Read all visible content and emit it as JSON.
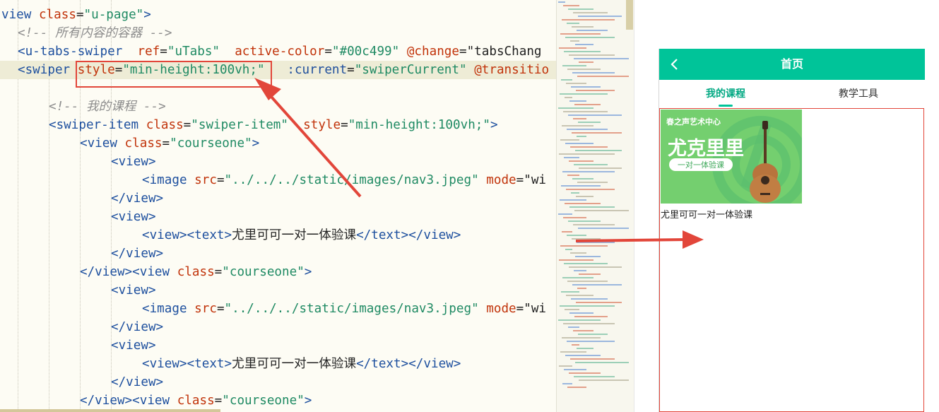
{
  "editor": {
    "lines": [
      [
        [
          "tag",
          "view"
        ],
        [
          "attr",
          " class"
        ],
        [
          "txt",
          "="
        ],
        [
          "str",
          "\"u-page\""
        ],
        [
          "tag",
          ">"
        ]
      ],
      [
        [
          "cmt",
          "<!-- 所有内容的容器 -->"
        ]
      ],
      [
        [
          "tag",
          "<u-tabs-swiper"
        ],
        [
          "attr",
          "  ref"
        ],
        [
          "txt",
          "="
        ],
        [
          "str",
          "\"uTabs\""
        ],
        [
          "attr",
          "  active-color"
        ],
        [
          "txt",
          "="
        ],
        [
          "str",
          "\"#00c499\""
        ],
        [
          "ev",
          " @change"
        ],
        [
          "txt",
          "=\"tabsChang"
        ]
      ],
      [
        [
          "tag",
          "<swiper"
        ],
        [
          "txt",
          " "
        ],
        [
          "attr",
          "style"
        ],
        [
          "txt",
          "="
        ],
        [
          "str",
          "\"min-height:100vh;\""
        ],
        [
          "txt",
          "  "
        ],
        [
          "bind",
          " :current"
        ],
        [
          "txt",
          "="
        ],
        [
          "str",
          "\"swiperCurrent\""
        ],
        [
          "txt",
          " "
        ],
        [
          "ev",
          "@transitio"
        ]
      ],
      [],
      [
        [
          "cmt",
          "<!-- 我的课程 -->"
        ]
      ],
      [
        [
          "tag",
          "<swiper-item"
        ],
        [
          "attr",
          " class"
        ],
        [
          "txt",
          "="
        ],
        [
          "str",
          "\"swiper-item\""
        ],
        [
          "attr",
          "  style"
        ],
        [
          "txt",
          "="
        ],
        [
          "str",
          "\"min-height:100vh;\""
        ],
        [
          "tag",
          ">"
        ]
      ],
      [
        [
          "tag",
          "<view"
        ],
        [
          "attr",
          " class"
        ],
        [
          "txt",
          "="
        ],
        [
          "str",
          "\"courseone\""
        ],
        [
          "tag",
          ">"
        ]
      ],
      [
        [
          "tag",
          "<view>"
        ]
      ],
      [
        [
          "tag",
          "<image"
        ],
        [
          "attr",
          " src"
        ],
        [
          "txt",
          "="
        ],
        [
          "str",
          "\"../../../static/images/nav3.jpeg\""
        ],
        [
          "attr",
          " mode"
        ],
        [
          "txt",
          "=\"wi"
        ]
      ],
      [
        [
          "tag",
          "</view>"
        ]
      ],
      [
        [
          "tag",
          "<view>"
        ]
      ],
      [
        [
          "tag",
          "<view><text>"
        ],
        [
          "txt",
          "尤里可可一对一体验课"
        ],
        [
          "tag",
          "</text></view>"
        ]
      ],
      [
        [
          "tag",
          "</view>"
        ]
      ],
      [
        [
          "tag",
          "</view><view"
        ],
        [
          "attr",
          " class"
        ],
        [
          "txt",
          "="
        ],
        [
          "str",
          "\"courseone\""
        ],
        [
          "tag",
          ">"
        ]
      ],
      [
        [
          "tag",
          "<view>"
        ]
      ],
      [
        [
          "tag",
          "<image"
        ],
        [
          "attr",
          " src"
        ],
        [
          "txt",
          "="
        ],
        [
          "str",
          "\"../../../static/images/nav3.jpeg\""
        ],
        [
          "attr",
          " mode"
        ],
        [
          "txt",
          "=\"wi"
        ]
      ],
      [
        [
          "tag",
          "</view>"
        ]
      ],
      [
        [
          "tag",
          "<view>"
        ]
      ],
      [
        [
          "tag",
          "<view><text>"
        ],
        [
          "txt",
          "尤里可可一对一体验课"
        ],
        [
          "tag",
          "</text></view>"
        ]
      ],
      [
        [
          "tag",
          "</view>"
        ]
      ],
      [
        [
          "tag",
          "</view><view"
        ],
        [
          "attr",
          " class"
        ],
        [
          "txt",
          "="
        ],
        [
          "str",
          "\"courseone\""
        ],
        [
          "tag",
          ">"
        ]
      ]
    ]
  },
  "phone": {
    "title": "首页",
    "tabs": [
      "我的课程",
      "教学工具"
    ],
    "active_tab": 0,
    "course": {
      "brand": "春之声艺术中心",
      "headline": "尤克里里",
      "badge": "一对一体验课",
      "caption": "尤里可可一对一体验课"
    }
  },
  "colors": {
    "accent": "#00c499",
    "annotation": "#e2463a"
  }
}
